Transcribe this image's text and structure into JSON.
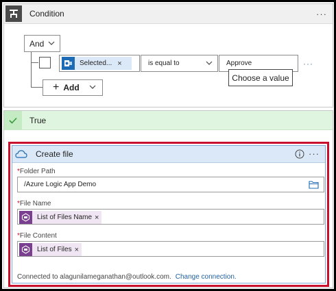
{
  "condition": {
    "title": "Condition",
    "more": "···",
    "and_label": "And",
    "token_label": "Selected...",
    "token_remove": "×",
    "operator": "is equal to",
    "value": "Approve",
    "row_more": "···",
    "tooltip": "Choose a value",
    "add_label": "Add"
  },
  "true_branch": {
    "title": "True"
  },
  "create_file": {
    "title": "Create file",
    "more": "···",
    "required_marker": "*",
    "folder_path_label": "Folder Path",
    "folder_path_value": "/Azure Logic App Demo",
    "file_name_label": "File Name",
    "file_name_token": "List of Files Name",
    "file_content_label": "File Content",
    "file_content_token": "List of Files",
    "token_remove": "×",
    "connected_text": "Connected to alagunilameganathan@outlook.com.",
    "change_connection": "Change connection."
  },
  "colors": {
    "highlight_border": "#c8102e",
    "accent_blue": "#1d6bb5",
    "token_purple": "#7b3f90",
    "true_header": "#dff5df"
  }
}
